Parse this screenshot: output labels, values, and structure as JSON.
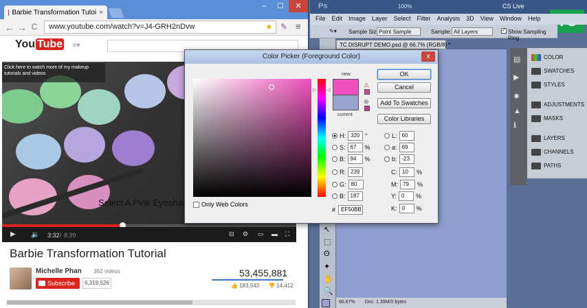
{
  "browser": {
    "tab_title": "Barbie Transformation Tutoi",
    "tab_close": "×",
    "url": "www.youtube.com/watch?v=J4-GRH2nDvw",
    "nav_back": "←",
    "nav_forward": "→",
    "nav_reload": "C",
    "win_min": "–",
    "win_max": "☐",
    "win_close": "✕"
  },
  "youtube": {
    "logo_you": "You",
    "logo_tube": "Tube",
    "promo_text": "Click here to watch more of my makeup tutorials and videos",
    "video_caption": "Select A Pink Eyeshac",
    "time_current": "3:32",
    "time_total": "8:39",
    "title": "Barbie Transformation Tutorial",
    "channel": "Michelle Phan",
    "video_count": "362 videos",
    "subscribe_label": "Subscribe",
    "subscriber_count": "6,319,526",
    "views": "53,455,881",
    "likes": "183,543",
    "dislikes": "14,412",
    "progress_fraction": 0.41
  },
  "photoshop": {
    "menu": [
      "File",
      "Edit",
      "Image",
      "Layer",
      "Select",
      "Filter",
      "Analysis",
      "3D",
      "View",
      "Window",
      "Help"
    ],
    "cs_live": "CS Live",
    "sample_size_label": "Sample Size:",
    "sample_size_value": "Point Sample",
    "sample_label": "Sample:",
    "sample_value": "All Layers",
    "show_ring": "Show Sampling Ring",
    "zoom_top": "100%",
    "doc_tab": "TC DISRUPT DEMO.psd @ 66.7% (RGB/8) *",
    "status_zoom": "66.67%",
    "status_doc": "Doc: 1.39M/0 bytes",
    "panels": [
      "COLOR",
      "SWATCHES",
      "STYLES",
      "ADJUSTMENTS",
      "MASKS",
      "LAYERS",
      "CHANNELS",
      "PATHS"
    ],
    "tc_logo": "TC"
  },
  "color_picker": {
    "title": "Color Picker (Foreground Color)",
    "close": "x",
    "new_label": "new",
    "current_label": "current",
    "ok": "OK",
    "cancel": "Cancel",
    "add_to_swatches": "Add To Swatches",
    "color_libraries": "Color Libraries",
    "only_web_colors": "Only Web Colors",
    "new_color": "#ef50bb",
    "current_color": "#9aa3cf",
    "fields": {
      "H": {
        "label": "H:",
        "value": "320",
        "unit": "°"
      },
      "S": {
        "label": "S:",
        "value": "67",
        "unit": "%"
      },
      "B": {
        "label": "B:",
        "value": "94",
        "unit": "%"
      },
      "R": {
        "label": "R:",
        "value": "239",
        "unit": ""
      },
      "G": {
        "label": "G:",
        "value": "80",
        "unit": ""
      },
      "Bl": {
        "label": "B:",
        "value": "187",
        "unit": ""
      },
      "L": {
        "label": "L:",
        "value": "60",
        "unit": ""
      },
      "a": {
        "label": "a:",
        "value": "69",
        "unit": ""
      },
      "b": {
        "label": "b:",
        "value": "-23",
        "unit": ""
      },
      "C": {
        "label": "C:",
        "value": "10",
        "unit": "%"
      },
      "M": {
        "label": "M:",
        "value": "79",
        "unit": "%"
      },
      "Y": {
        "label": "Y:",
        "value": "0",
        "unit": "%"
      },
      "K": {
        "label": "K:",
        "value": "0",
        "unit": "%"
      }
    },
    "hex_label": "#",
    "hex_value": "EF50BB"
  }
}
